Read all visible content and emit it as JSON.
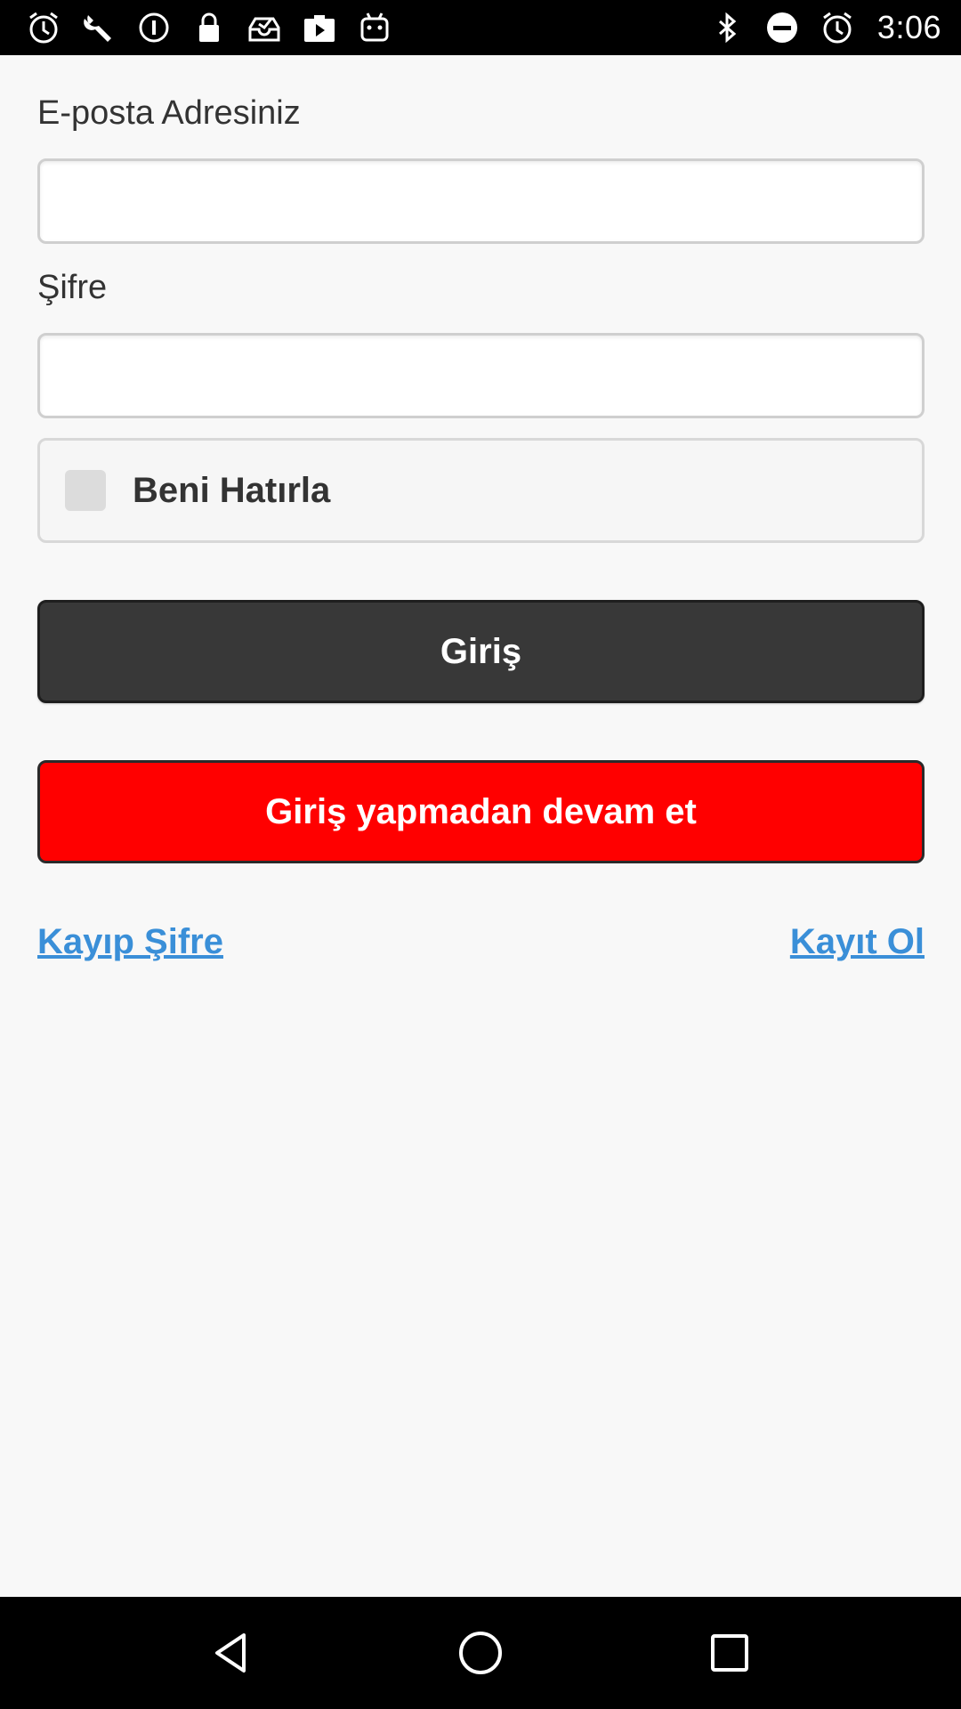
{
  "status_bar": {
    "time": "3:06",
    "left_icons": [
      "alarm-icon",
      "wrench-icon",
      "info-icon",
      "lock-icon",
      "inbox-icon",
      "play-icon",
      "android-icon"
    ],
    "right_icons": [
      "bluetooth-icon",
      "do-not-disturb-icon",
      "alarm-icon"
    ]
  },
  "form": {
    "email_label": "E-posta Adresiniz",
    "email_value": "",
    "email_placeholder": "",
    "password_label": "Şifre",
    "password_value": "",
    "password_placeholder": "",
    "remember_label": "Beni Hatırla",
    "remember_checked": false
  },
  "buttons": {
    "login": "Giriş",
    "guest": "Giriş yapmadan devam et"
  },
  "links": {
    "lost_password": "Kayıp Şifre",
    "register": "Kayıt Ol"
  },
  "colors": {
    "login_button": "#383838",
    "guest_button": "#ff0000",
    "link": "#3a8fd8",
    "background": "#f8f8f8"
  },
  "nav_bar": [
    "back-icon",
    "home-icon",
    "recents-icon"
  ]
}
